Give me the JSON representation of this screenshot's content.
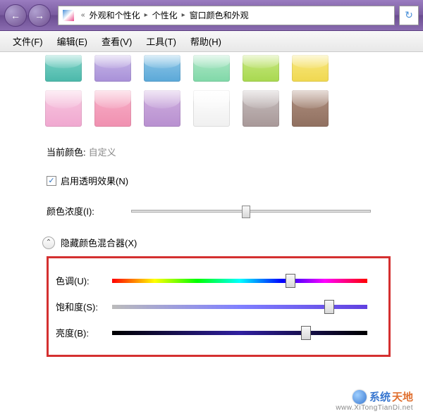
{
  "nav": {
    "back_glyph": "←",
    "fwd_glyph": "→",
    "double_left": "«",
    "refresh_glyph": "↻",
    "sep": "▸",
    "crumbs": [
      "外观和个性化",
      "个性化",
      "窗口颜色和外观"
    ]
  },
  "menu": {
    "file": "文件(F)",
    "edit": "编辑(E)",
    "view": "查看(V)",
    "tools": "工具(T)",
    "help": "帮助(H)"
  },
  "swatches_row1": [
    "teal",
    "lav",
    "blue",
    "mint",
    "lime",
    "yel"
  ],
  "swatches_row2": [
    "pink",
    "rose",
    "purp",
    "white",
    "gray",
    "brown"
  ],
  "current_color": {
    "label": "当前颜色:",
    "value": "自定义"
  },
  "transparency": {
    "label": "启用透明效果(N)",
    "checked": true,
    "check_glyph": "✓"
  },
  "intensity": {
    "label": "颜色浓度(I):",
    "value_pct": 48
  },
  "mixer_toggle": {
    "glyph": "⌃",
    "label": "隐藏颜色混合器(X)"
  },
  "mixer": {
    "hue": {
      "label": "色调(U):",
      "value_pct": 70
    },
    "sat": {
      "label": "饱和度(S):",
      "value_pct": 85
    },
    "bri": {
      "label": "亮度(B):",
      "value_pct": 76
    }
  },
  "watermark": {
    "brand1": "系统",
    "brand2": "天地",
    "url": "www.XiTongTianDi.net"
  }
}
